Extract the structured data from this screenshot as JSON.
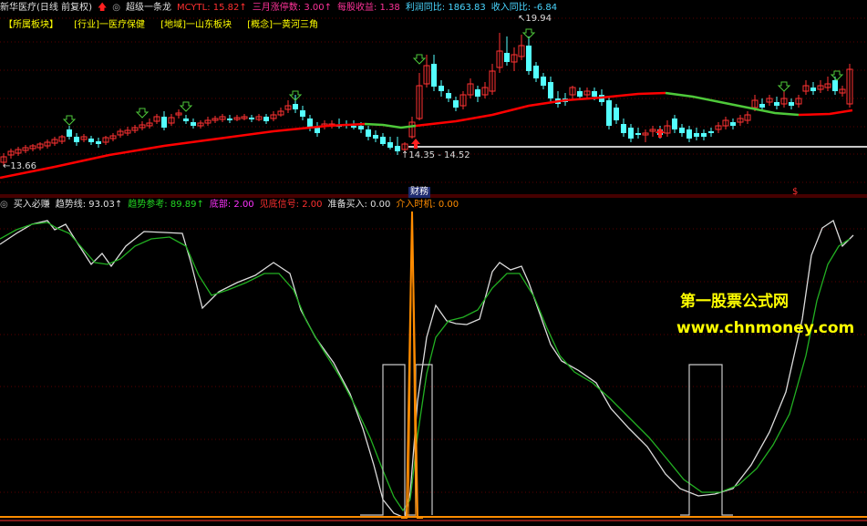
{
  "top_header": {
    "stock_name": "新华医疗",
    "period": "(日线 前复权)",
    "indicator_name": "超级一条龙",
    "mcytl": "MCYTL: 15.82↑",
    "limit_up": "三月涨停数: 3.00↑",
    "eps": "每股收益: 1.38",
    "profit_yoy": "利润同比: 1863.83",
    "revenue_yoy": "收入同比: -6.84"
  },
  "sector_bar": {
    "items": [
      "【所属板块】",
      "[行业]一医疗保健",
      "[地域]一山东板块",
      "[概念]一黄河三角"
    ]
  },
  "price_annotations": {
    "high": "19.94",
    "low_left": "13.66",
    "range": "14.35 - 14.52"
  },
  "fin_tag": "财",
  "fin_tag2": "務",
  "dollar_mark": "$",
  "indicator_header": {
    "title": "买入必赚",
    "trend": "趋势线: 93.03↑",
    "trend_ref": "趋势参考: 89.89↑",
    "bottom": "底部: 2.00",
    "bottom_signal": "见底信号: 2.00",
    "prepare_buy": "准备买入: 0.00",
    "entry_time": "介入时机: 0.00"
  },
  "watermark": {
    "line1": "第一股票公式网",
    "line2": "www.chnmoney.com"
  },
  "colors": {
    "up": "#ff3232",
    "down": "#54ffff",
    "ma_red": "#ff0000",
    "ma_green": "#4ec83a",
    "white_line": "#dcdcdc",
    "green_line": "#22b022",
    "orange": "#ff8c00"
  }
}
